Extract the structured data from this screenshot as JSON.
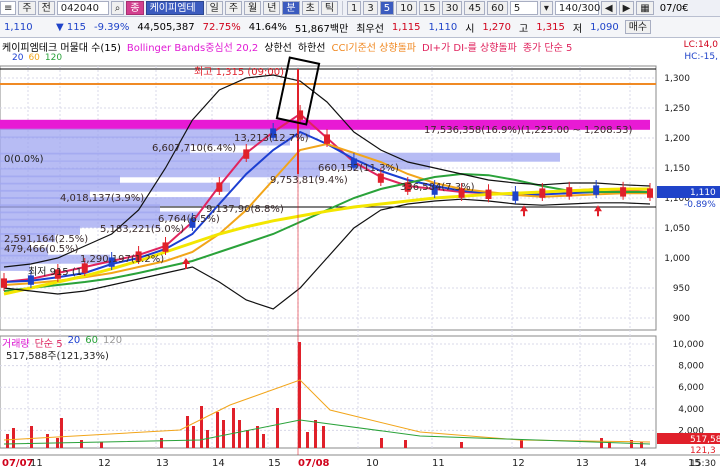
{
  "toolbar": {
    "menu_icon": "list-icon",
    "label_ju": "주",
    "label_jeon": "전",
    "code": "042040",
    "search_icon": "search-icon",
    "name_badge": "종",
    "name": "케이피엠테",
    "periods": [
      "일",
      "주",
      "월",
      "년",
      "분",
      "초",
      "틱"
    ],
    "period_active": "분",
    "minutes": [
      "1",
      "3",
      "5",
      "10",
      "15",
      "30",
      "45",
      "60"
    ],
    "minute_active": "5",
    "minute_input": "5",
    "count": "140/300",
    "nav_left": "◀",
    "nav_right": "▶",
    "date_partial": "07/0€"
  },
  "quote": {
    "price": "1,110",
    "change": "115",
    "change_pct": "-9.39%",
    "volume": "44,505,387",
    "ratio1": "72.75%",
    "ratio2": "41.64%",
    "amount": "51,867백만",
    "label_best_first": "최우선",
    "ask": "1,115",
    "bid": "1,110",
    "open_label": "시",
    "open": "1,270",
    "high_label": "고",
    "high": "1,315",
    "low_label": "저",
    "low": "1,090",
    "order_button": "매수"
  },
  "legend": {
    "title": "케이피엠테크 머물대 수(15)",
    "boll": "Bollinger Bands중심선 20,2",
    "upper": "상한선",
    "lower": "하한선",
    "cci": "CCI기준선 상향돌파",
    "dmi": "DI+가 DI-를 상향돌파",
    "close_ma": "종가 단순 5",
    "lc": "LC:14,0",
    "hc": "HC:-15,"
  },
  "ma_legend": [
    "20",
    "60",
    "120"
  ],
  "colors": {
    "ma5": "#e0245e",
    "ma20": "#1c3fd1",
    "ma60": "#f2a51a",
    "ma120": "#2aa23a",
    "ma240": "#f3e600",
    "boll": "#111111",
    "bars": "#9fa6f0",
    "magenta": "#e81ad4",
    "orange": "#f08a24",
    "up": "#e0202a",
    "down": "#1f43c9"
  },
  "price_axis": {
    "ticks": [
      "1,300",
      "1,250",
      "1,200",
      "1,150",
      "1,100",
      "1,050",
      "1,000",
      "950",
      "900"
    ],
    "current": "1,110",
    "current2": "-0.89%"
  },
  "annotations": {
    "high": "최고 1,315 (09:00)",
    "zero": "0(0.0%)",
    "low_label": "최저 915 (1",
    "profile": [
      "17,536,358(16.9%)(1,225.00 ~ 1,208.53)",
      "6,607,710(6.4%)",
      "13,213(12.7%)",
      "9,753,81(9.4%)",
      "660,152(11.3%)",
      "336,584(7.3%)",
      "4,018,137(3.9%)",
      "9,137,90(8.8%)",
      "6,764(6.5%)",
      "5,183,221(5.0%)",
      "2,591,164(2.5%)",
      "479,466(0.5%)",
      "1,290,197(1.2%)"
    ]
  },
  "chart_data": {
    "type": "line",
    "title": "케이피엠테크 머물대 수(15)",
    "xlabel": "",
    "ylabel": "",
    "ylim": [
      880,
      1320
    ],
    "x_tick_labels": [
      "07/07",
      "11",
      "12",
      "13",
      "14",
      "15",
      "07/08",
      "10",
      "11",
      "12",
      "13",
      "14",
      "15"
    ],
    "series": [
      {
        "name": "",
        "values": [
          960,
          965,
          975,
          985,
          995,
          1005,
          1020,
          1060,
          1120,
          1175,
          1210,
          1240,
          1200,
          1160,
          1135,
          1120,
          1115,
          1110,
          1108,
          1105,
          1110,
          1112,
          1115,
          1112,
          1110
        ]
      },
      {
        "name": "20",
        "values": [
          960,
          962,
          968,
          975,
          990,
          1000,
          1015,
          1040,
          1090,
          1140,
          1180,
          1210,
          1190,
          1165,
          1145,
          1130,
          1120,
          1112,
          1108,
          1105,
          1106,
          1108,
          1110,
          1110,
          1110
        ]
      },
      {
        "name": "60",
        "values": [
          955,
          958,
          962,
          968,
          975,
          985,
          995,
          1010,
          1040,
          1080,
          1130,
          1180,
          1190,
          1175,
          1160,
          1140,
          1125,
          1115,
          1110,
          1105,
          1102,
          1104,
          1106,
          1108,
          1108
        ]
      },
      {
        "name": "120",
        "values": [
          945,
          950,
          955,
          960,
          966,
          975,
          985,
          995,
          1010,
          1025,
          1040,
          1060,
          1080,
          1100,
          1115,
          1125,
          1135,
          1140,
          1138,
          1130,
          1120,
          1112,
          1110,
          1110,
          1110
        ]
      }
    ],
    "volume": {
      "label": "거래량",
      "ma_label": "단순 5",
      "ma_periods": [
        "20",
        "60",
        "120"
      ],
      "value": "517,588주(121,33%)",
      "ticks": [
        "10,000",
        "8,000",
        "6,000",
        "4,000",
        "2,000"
      ],
      "right_values": [
        "517,58",
        "121,3"
      ],
      "unit": "15:30"
    }
  }
}
